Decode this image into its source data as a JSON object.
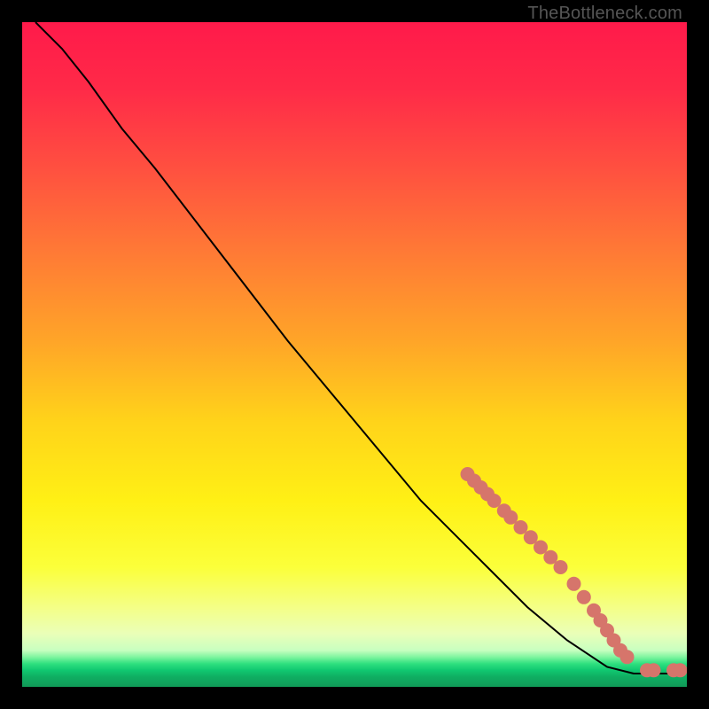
{
  "watermark": "TheBottleneck.com",
  "chart_data": {
    "type": "line",
    "title": "",
    "xlabel": "",
    "ylabel": "",
    "xlim": [
      0,
      100
    ],
    "ylim": [
      0,
      100
    ],
    "curve": [
      {
        "x": 2,
        "y": 100
      },
      {
        "x": 6,
        "y": 96
      },
      {
        "x": 10,
        "y": 91
      },
      {
        "x": 15,
        "y": 84
      },
      {
        "x": 20,
        "y": 78
      },
      {
        "x": 30,
        "y": 65
      },
      {
        "x": 40,
        "y": 52
      },
      {
        "x": 50,
        "y": 40
      },
      {
        "x": 60,
        "y": 28
      },
      {
        "x": 70,
        "y": 18
      },
      {
        "x": 76,
        "y": 12
      },
      {
        "x": 82,
        "y": 7
      },
      {
        "x": 88,
        "y": 3
      },
      {
        "x": 92,
        "y": 2
      },
      {
        "x": 96,
        "y": 2
      },
      {
        "x": 99,
        "y": 2
      }
    ],
    "markers": [
      {
        "x": 67.0,
        "y": 32.0
      },
      {
        "x": 68.0,
        "y": 31.0
      },
      {
        "x": 69.0,
        "y": 30.0
      },
      {
        "x": 70.0,
        "y": 29.0
      },
      {
        "x": 71.0,
        "y": 28.0
      },
      {
        "x": 72.5,
        "y": 26.5
      },
      {
        "x": 73.5,
        "y": 25.5
      },
      {
        "x": 75.0,
        "y": 24.0
      },
      {
        "x": 76.5,
        "y": 22.5
      },
      {
        "x": 78.0,
        "y": 21.0
      },
      {
        "x": 79.5,
        "y": 19.5
      },
      {
        "x": 81.0,
        "y": 18.0
      },
      {
        "x": 83.0,
        "y": 15.5
      },
      {
        "x": 84.5,
        "y": 13.5
      },
      {
        "x": 86.0,
        "y": 11.5
      },
      {
        "x": 87.0,
        "y": 10.0
      },
      {
        "x": 88.0,
        "y": 8.5
      },
      {
        "x": 89.0,
        "y": 7.0
      },
      {
        "x": 90.0,
        "y": 5.5
      },
      {
        "x": 91.0,
        "y": 4.5
      },
      {
        "x": 94.0,
        "y": 2.5
      },
      {
        "x": 95.0,
        "y": 2.5
      },
      {
        "x": 98.0,
        "y": 2.5
      },
      {
        "x": 99.0,
        "y": 2.5
      }
    ],
    "marker_color": "#d6756b",
    "line_color": "#000000",
    "gradient_stops": [
      {
        "offset": 0.0,
        "color": "#ff1a4a"
      },
      {
        "offset": 0.1,
        "color": "#ff2a48"
      },
      {
        "offset": 0.22,
        "color": "#ff5040"
      },
      {
        "offset": 0.35,
        "color": "#ff7b35"
      },
      {
        "offset": 0.48,
        "color": "#ffa528"
      },
      {
        "offset": 0.6,
        "color": "#ffd31a"
      },
      {
        "offset": 0.72,
        "color": "#fff015"
      },
      {
        "offset": 0.82,
        "color": "#fbff3a"
      },
      {
        "offset": 0.88,
        "color": "#f4ff86"
      },
      {
        "offset": 0.92,
        "color": "#eaffb8"
      },
      {
        "offset": 0.945,
        "color": "#c8ffc0"
      },
      {
        "offset": 0.955,
        "color": "#80f5a0"
      },
      {
        "offset": 0.965,
        "color": "#30e080"
      },
      {
        "offset": 0.975,
        "color": "#10c870"
      },
      {
        "offset": 0.985,
        "color": "#0fae62"
      },
      {
        "offset": 1.0,
        "color": "#109a58"
      }
    ]
  }
}
